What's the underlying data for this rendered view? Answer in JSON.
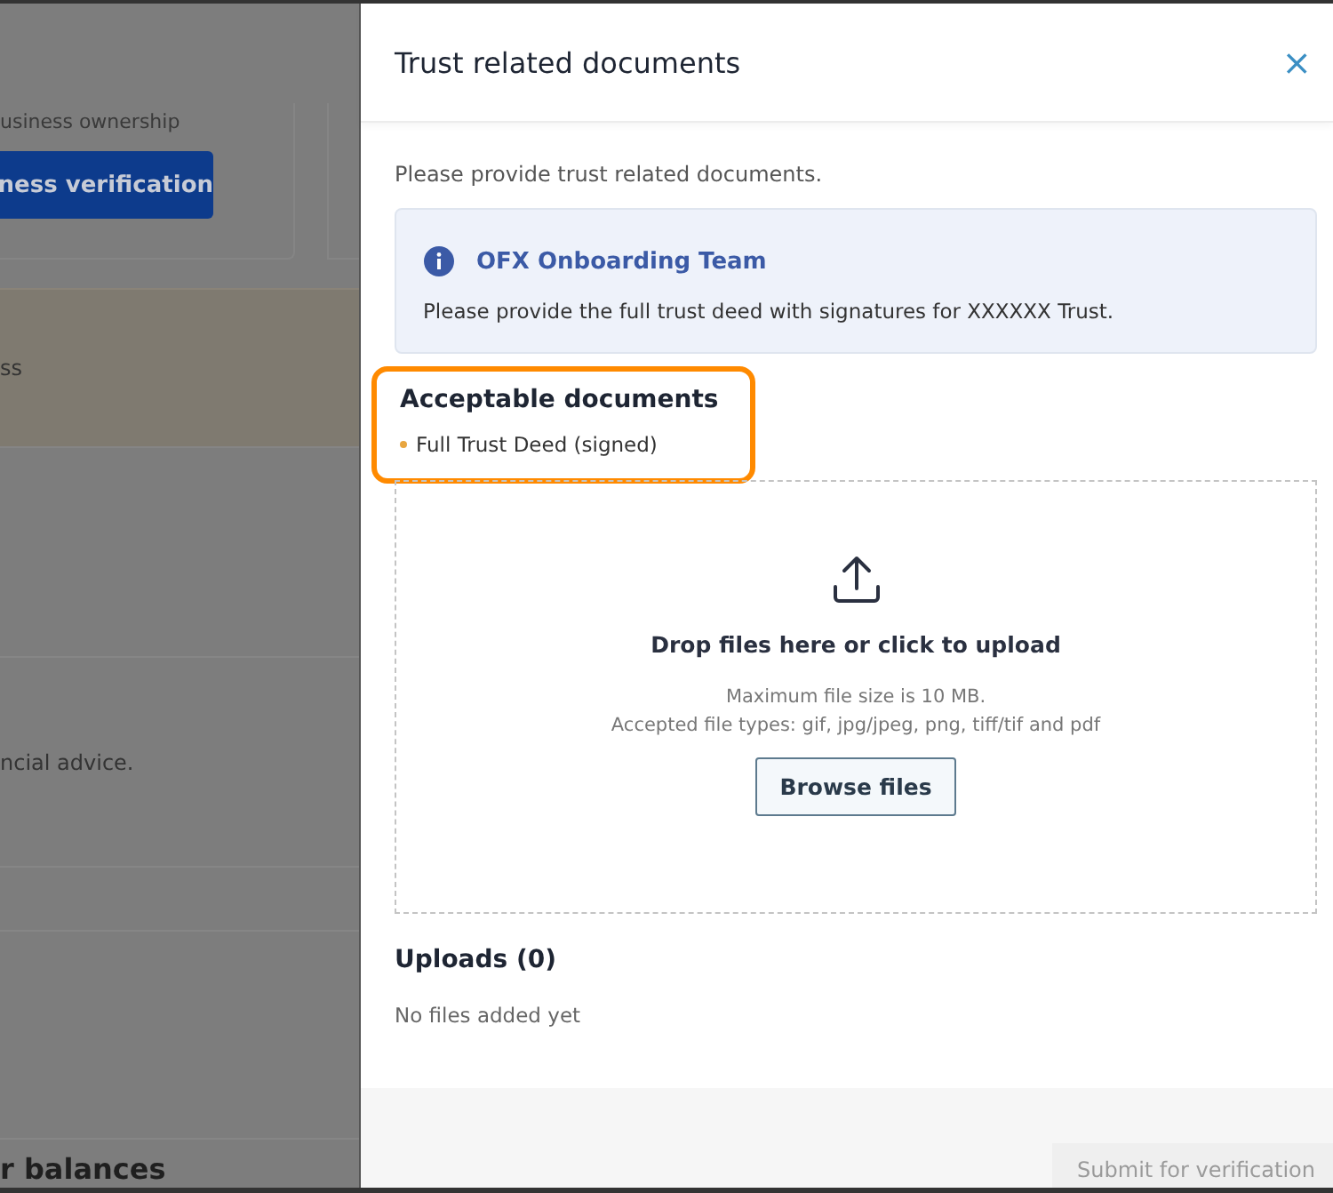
{
  "background_page": {
    "ownership_text": "usiness ownership",
    "verify_button": "ness verification",
    "notice_text": "ss",
    "advice_text": "ncial advice.",
    "balances_heading": "r balances"
  },
  "panel": {
    "title": "Trust related documents",
    "close_icon": "×",
    "intro": "Please provide trust related documents.",
    "message": {
      "sender": "OFX Onboarding Team",
      "text": "Please provide the full trust deed with signatures for XXXXXX Trust."
    },
    "acceptable": {
      "heading": "Acceptable documents",
      "highlighted": true,
      "items": [
        "Full Trust Deed (signed)"
      ]
    },
    "dropzone": {
      "prompt": "Drop files here or click to upload",
      "max_size": "Maximum file size is 10 MB.",
      "file_types": "Accepted file types: gif, jpg/jpeg, png, tiff/tif and pdf",
      "button": "Browse files"
    },
    "uploads": {
      "heading": "Uploads (0)",
      "empty_text": "No files added yet"
    },
    "submit": {
      "label": "Submit for verification",
      "disabled": true
    }
  }
}
